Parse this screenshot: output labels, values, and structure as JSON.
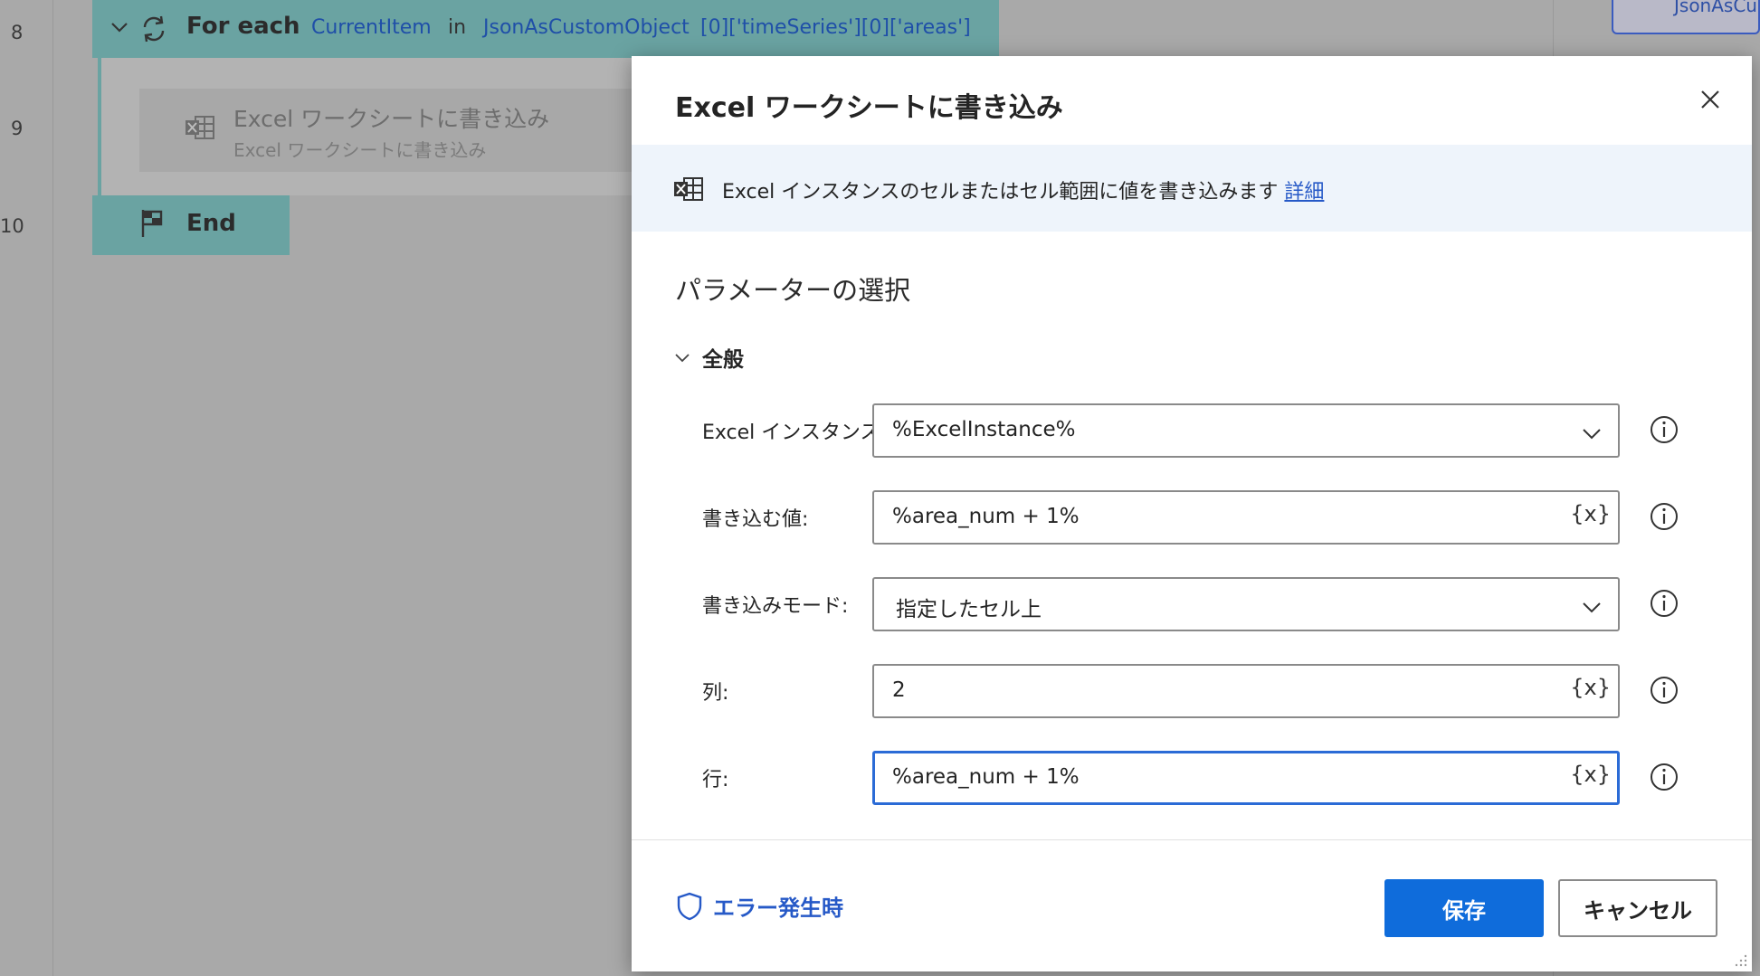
{
  "flow": {
    "line_numbers": [
      "8",
      "9",
      "10"
    ],
    "foreach": {
      "title": "For each",
      "item_var": "CurrentItem",
      "in_label": "in",
      "source": "JsonAsCustomObject",
      "path": "[0]['timeSeries'][0]['areas']"
    },
    "step": {
      "title": "Excel ワークシートに書き込み",
      "subtitle": "Excel ワークシートに書き込み"
    },
    "end_label": "End",
    "variables_panel_label": "JsonAsCu"
  },
  "dialog": {
    "title": "Excel ワークシートに書き込み",
    "info_text": "Excel インスタンスのセルまたはセル範囲に値を書き込みます",
    "info_link": "詳細",
    "section_title": "パラメーターの選択",
    "group_label": "全般",
    "params": [
      {
        "label": "Excel インスタンス:",
        "value": "%ExcelInstance%",
        "kind": "dropdown"
      },
      {
        "label": "書き込む値:",
        "value": "%area_num + 1%",
        "kind": "variable"
      },
      {
        "label": "書き込みモード:",
        "value": "指定したセル上",
        "kind": "dropdown"
      },
      {
        "label": "列:",
        "value": "2",
        "kind": "variable"
      },
      {
        "label": "行:",
        "value": "%area_num + 1%",
        "kind": "variable"
      }
    ],
    "var_button": "{x}",
    "error_handler_label": "エラー発生時",
    "save_label": "保存",
    "cancel_label": "キャンセル"
  },
  "colors": {
    "accent": "#0f6cdb",
    "link": "#2659c7",
    "flow_block": "#6aa3a2",
    "info_banner": "#eef4fb"
  }
}
